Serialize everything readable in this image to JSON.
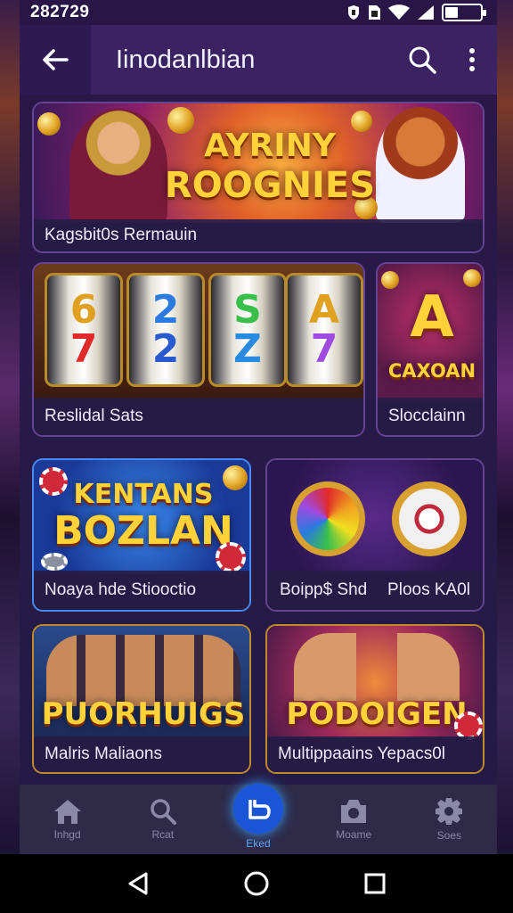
{
  "status": {
    "time": "282729"
  },
  "app_bar": {
    "title": "Iinodanlbian"
  },
  "cards": {
    "featured": {
      "art_title_1": "AYRINY",
      "art_title_2": "ROOGNIES",
      "label": "Kagsbit0s Rermauin"
    },
    "slots": {
      "reel_1_top": "6",
      "reel_1_bottom": "7",
      "reel_2_top": "2",
      "reel_2_bottom": "2",
      "reel_3_top": "S",
      "reel_3_bottom": "Z",
      "reel_4_top": "A",
      "reel_4_bottom": "7",
      "label": "Reslidal Sats"
    },
    "cayan": {
      "art_letter": "A",
      "art_title": "CAXOAN",
      "label": "Slocclainn"
    },
    "kentans": {
      "art_title_1": "KENTANS",
      "art_title_2": "BOZLAN",
      "label": "Noaya hde Stiooctio"
    },
    "wheels": {
      "label_left": "Boipp$ Shd",
      "label_right": "Ploos KA0l"
    },
    "puorhuigs": {
      "art_title": "PUORHUIGS",
      "label": "Malris Maliaons"
    },
    "podoigen": {
      "art_title": "PODOIGEN",
      "label": "Multippaains Yepacs0l"
    }
  },
  "bottom_nav": [
    {
      "label": "Inhgd",
      "icon": "home-icon"
    },
    {
      "label": "Rcat",
      "icon": "search-icon"
    },
    {
      "label": "Eked",
      "icon": "b-icon",
      "active": true
    },
    {
      "label": "Moame",
      "icon": "shop-icon"
    },
    {
      "label": "Soes",
      "icon": "gear-icon"
    }
  ],
  "colors": {
    "accent": "#1a55d8",
    "background": "#281a4a",
    "gold": "#ffd23a"
  }
}
